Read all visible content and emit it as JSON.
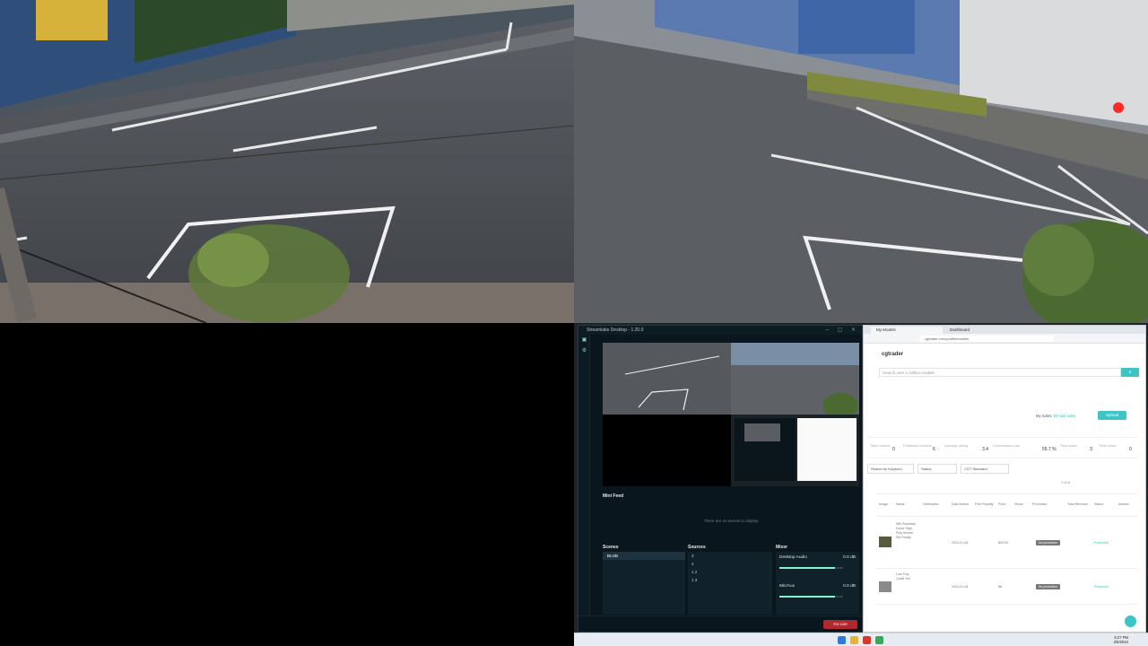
{
  "streamlabs": {
    "title": "Streamlabs Desktop - 1.20.0",
    "window_controls": "– ▢ ✕",
    "minifeed": {
      "title": "Mini Feed",
      "empty_text": "There are no events to display"
    },
    "scenes": {
      "title": "Scenes",
      "items": [
        "BLOB"
      ]
    },
    "sources": {
      "title": "Sources",
      "items": [
        "3",
        "4",
        "1 2",
        "1 3"
      ]
    },
    "mixer": {
      "title": "Mixer",
      "channels": [
        {
          "name": "Desktop Audio",
          "db": "0.0 dB",
          "level": 0.88
        },
        {
          "name": "Mic/Aux",
          "db": "0.0 dB",
          "level": 0.88
        }
      ]
    },
    "go_live_label": "Go Live"
  },
  "browser": {
    "tabs": [
      "My Models",
      "Dashboard"
    ],
    "url": "cgtrader.com/profile/models",
    "site": {
      "logo": "cgtrader",
      "search_placeholder": "Search over 1 million models",
      "sales_prefix": "My Sales:",
      "sales_link": "$0 total sales",
      "upload_label": "Upload",
      "stats": [
        {
          "label": "Total models",
          "value": "0"
        },
        {
          "label": "Published models",
          "value": "6"
        },
        {
          "label": "Average rating",
          "value": "3.4"
        },
        {
          "label": "Commission rate",
          "value": "55.7 %"
        },
        {
          "label": "Total sales",
          "value": "3"
        },
        {
          "label": "Total views",
          "value": "0"
        }
      ],
      "filter_keyword_placeholder": "Search by Keyword",
      "filter_status": "Status",
      "filter_license": "CGT Standard",
      "pagination": "1 of 6",
      "columns": [
        "Image",
        "Name",
        "Verification",
        "Date Added",
        "Free Royalty",
        "Price",
        "Views",
        "Promotion",
        "Total Revenue",
        "Status",
        "Actions"
      ],
      "rows": [
        {
          "name": "WB Planetary Decor High Poly Animal Set Ready",
          "date": "2024-01-06",
          "price": "$29.00",
          "promo": "No promotion",
          "status": "Published"
        },
        {
          "name": "Low Poly Cable Set",
          "date": "2024-01-06",
          "price": "$8",
          "promo": "No promotion",
          "status": "Published"
        }
      ]
    }
  },
  "taskbar": {
    "time": "5:27 PM",
    "date": "2/6/2024"
  }
}
